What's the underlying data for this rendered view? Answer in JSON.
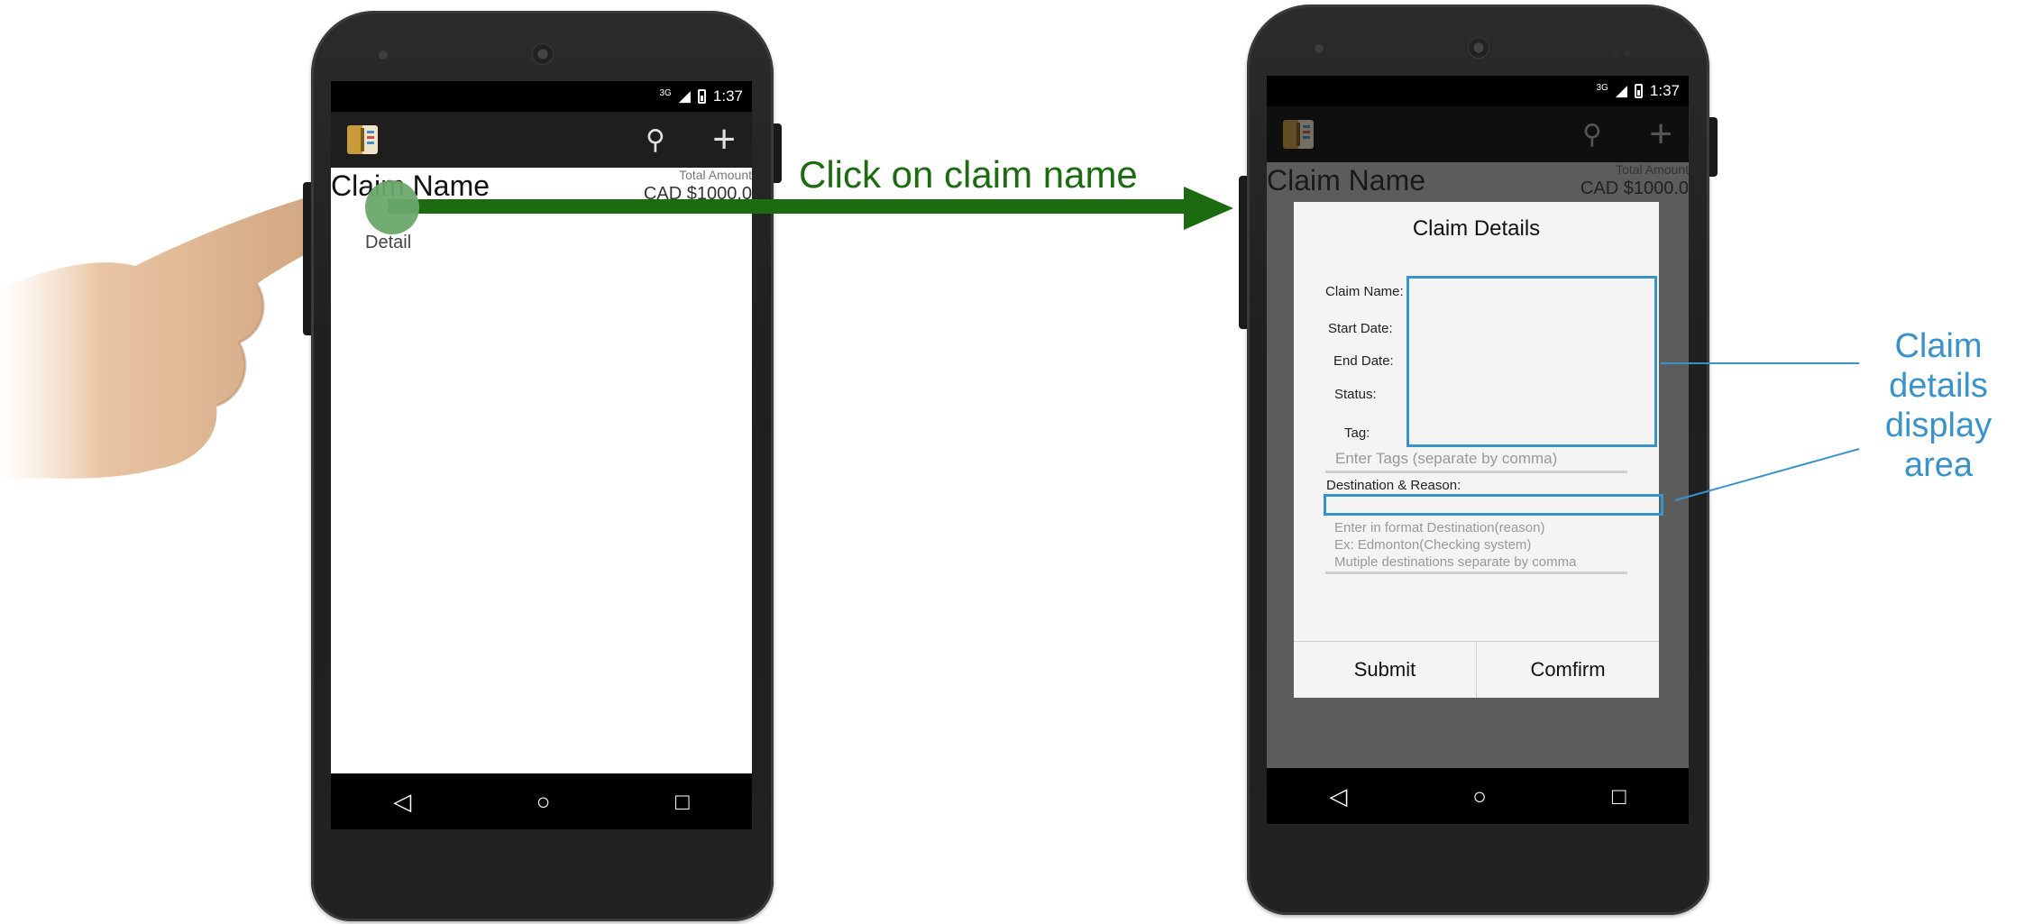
{
  "annotation": {
    "click_label": "Click on claim name",
    "callout_lines": [
      "Claim",
      "details",
      "display",
      "area"
    ],
    "arrow_color": "#1c6b11",
    "callout_color": "#3a93c8"
  },
  "left_phone": {
    "status": {
      "network": "3G",
      "time": "1:37"
    },
    "list_item": {
      "claim_name": "Claim Name",
      "total_label": "Total Amount",
      "total_amount": "CAD $1000.0",
      "detail": "Detail"
    }
  },
  "right_phone": {
    "status": {
      "network": "3G",
      "time": "1:37"
    },
    "background_item": {
      "claim_name": "Claim Name",
      "total_label": "Total Amount",
      "total_amount": "CAD $1000.0"
    },
    "dialog": {
      "title": "Claim Details",
      "labels": {
        "claim_name": "Claim Name:",
        "start_date": "Start Date:",
        "end_date": "End Date:",
        "status": "Status:",
        "tag": "Tag:",
        "destination": "Destination  & Reason:"
      },
      "tags_placeholder": "Enter Tags (separate by comma)",
      "destination_placeholder_lines": [
        "Enter in format  Destination(reason)",
        "Ex: Edmonton(Checking system)",
        "Mutiple destinations separate by comma"
      ],
      "submit_label": "Submit",
      "confirm_label": "Comfirm"
    }
  },
  "icons": [
    "search-icon",
    "add-icon",
    "app-icon",
    "back-icon",
    "home-icon",
    "recents-icon"
  ]
}
